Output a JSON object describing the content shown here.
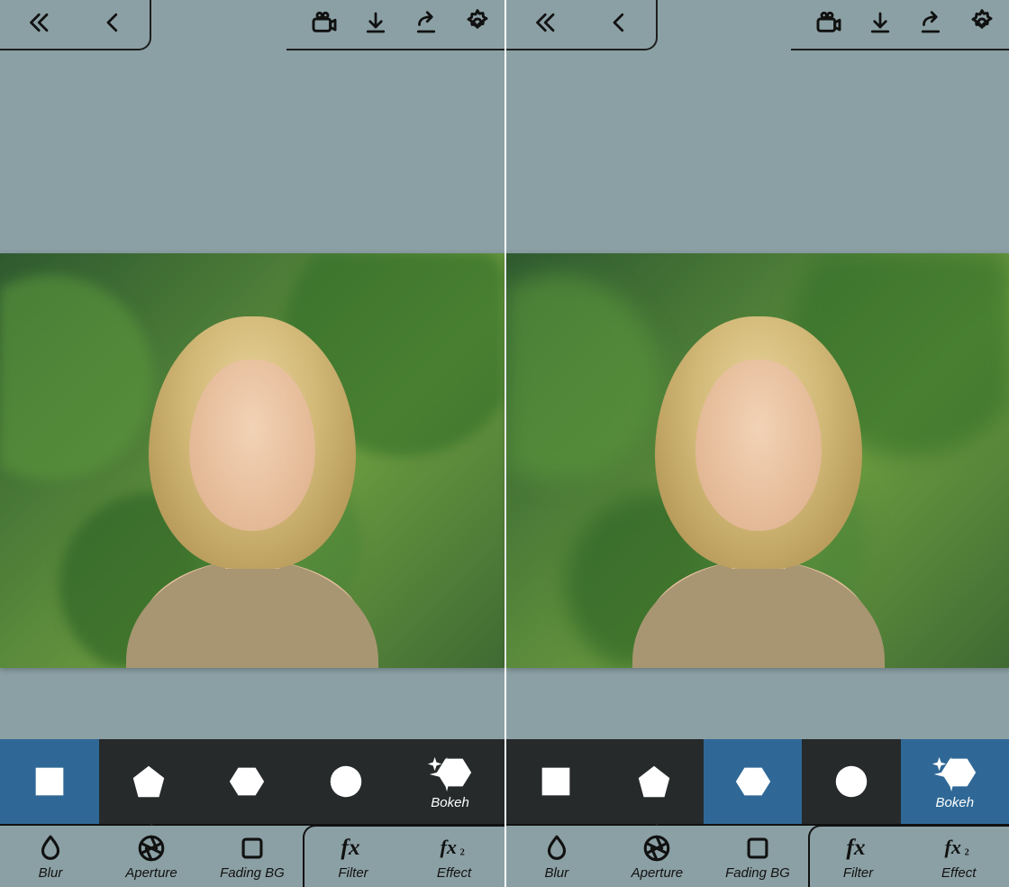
{
  "screens": [
    {
      "shapeStrip": {
        "items": [
          "square",
          "pentagon",
          "hexagon",
          "circle"
        ],
        "selectedIndex": 0,
        "bokehLabel": "Bokeh",
        "bokehSelected": false
      },
      "toolbar": {
        "items": [
          {
            "key": "blur",
            "label": "Blur"
          },
          {
            "key": "aperture",
            "label": "Aperture"
          },
          {
            "key": "fadingbg",
            "label": "Fading BG"
          },
          {
            "key": "filter",
            "label": "Filter"
          },
          {
            "key": "effect",
            "label": "Effect"
          }
        ],
        "selectedKey": "aperture"
      }
    },
    {
      "shapeStrip": {
        "items": [
          "square",
          "pentagon",
          "hexagon",
          "circle"
        ],
        "selectedIndex": 2,
        "bokehLabel": "Bokeh",
        "bokehSelected": true
      },
      "toolbar": {
        "items": [
          {
            "key": "blur",
            "label": "Blur"
          },
          {
            "key": "aperture",
            "label": "Aperture"
          },
          {
            "key": "fadingbg",
            "label": "Fading BG"
          },
          {
            "key": "filter",
            "label": "Filter"
          },
          {
            "key": "effect",
            "label": "Effect"
          }
        ],
        "selectedKey": "aperture"
      }
    }
  ]
}
